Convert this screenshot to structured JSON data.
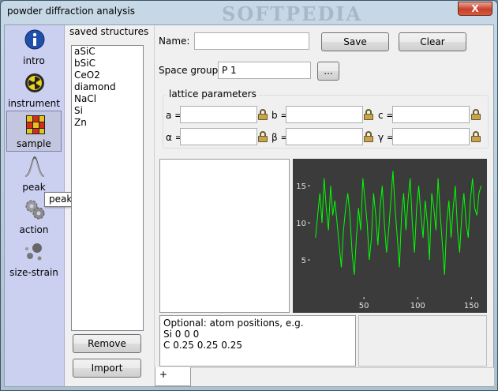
{
  "window": {
    "title": "powder diffraction analysis",
    "watermark": "SOFTPEDIA",
    "close_label": "X"
  },
  "sidebar": {
    "items": [
      {
        "label": "intro"
      },
      {
        "label": "instrument"
      },
      {
        "label": "sample"
      },
      {
        "label": "peak"
      },
      {
        "label": "action"
      },
      {
        "label": "size-strain"
      }
    ],
    "active": "sample",
    "tooltip": "peak"
  },
  "saved": {
    "label": "saved structures",
    "items": [
      "aSiC",
      "bSiC",
      "CeO2",
      "diamond",
      "NaCl",
      "Si",
      "Zn"
    ],
    "remove_label": "Remove",
    "import_label": "Import"
  },
  "form": {
    "name_label": "Name:",
    "name_value": "",
    "save_label": "Save",
    "clear_label": "Clear",
    "space_group_label": "Space group:",
    "space_group_value": "P 1",
    "browse_label": "...",
    "lattice_title": "lattice parameters",
    "params": [
      {
        "label": "a =",
        "value": ""
      },
      {
        "label": "b =",
        "value": ""
      },
      {
        "label": "c =",
        "value": ""
      },
      {
        "label": "α =",
        "value": ""
      },
      {
        "label": "β =",
        "value": ""
      },
      {
        "label": "γ =",
        "value": ""
      }
    ]
  },
  "atoms": {
    "lines": [
      "Optional: atom positions, e.g.",
      "Si 0 0 0",
      "C 0.25 0.25 0.25"
    ]
  },
  "tabs": [
    {
      "label": "+"
    }
  ],
  "chart_data": {
    "type": "line",
    "background": "#3b3b3b",
    "line_color": "#00ff00",
    "xlim": [
      0,
      160
    ],
    "ylim": [
      0,
      18
    ],
    "xticks": [
      50,
      100,
      150
    ],
    "yticks": [
      5,
      10,
      15
    ],
    "series": [
      {
        "x": [
          5,
          7,
          9,
          11,
          13,
          15,
          17,
          19,
          21,
          23,
          25,
          27,
          29,
          31,
          33,
          35,
          37,
          39,
          41,
          43,
          45,
          47,
          49,
          51,
          53,
          55,
          57,
          59,
          61,
          63,
          65,
          67,
          69,
          71,
          73,
          75,
          77,
          79,
          81,
          83,
          85,
          87,
          89,
          91,
          93,
          95,
          97,
          99,
          101,
          103,
          105,
          107,
          109,
          111,
          113,
          115,
          117,
          119,
          121,
          123,
          125,
          127,
          129,
          131,
          133,
          135,
          137,
          139,
          141,
          143,
          145,
          147,
          149,
          151,
          153,
          155,
          157,
          159
        ],
        "y": [
          8,
          11,
          14,
          10,
          16,
          12,
          9,
          15,
          11,
          13,
          10,
          7,
          4,
          9,
          12,
          14,
          11,
          6,
          3,
          8,
          12,
          9,
          16,
          13,
          10,
          5,
          8,
          14,
          11,
          7,
          12,
          15,
          10,
          6,
          9,
          13,
          17,
          12,
          8,
          4,
          11,
          14,
          9,
          13,
          16,
          10,
          6,
          12,
          15,
          11,
          8,
          13,
          10,
          5,
          14,
          12,
          9,
          16,
          11,
          7,
          3,
          10,
          13,
          8,
          12,
          15,
          9,
          6,
          11,
          14,
          10,
          8,
          13,
          16,
          12,
          11,
          14,
          15
        ]
      }
    ]
  }
}
